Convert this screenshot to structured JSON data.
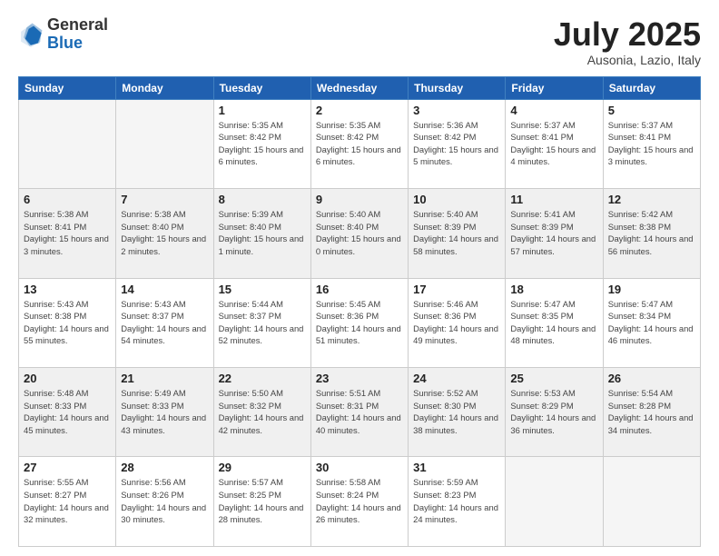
{
  "header": {
    "logo_general": "General",
    "logo_blue": "Blue",
    "month_title": "July 2025",
    "subtitle": "Ausonia, Lazio, Italy"
  },
  "weekdays": [
    "Sunday",
    "Monday",
    "Tuesday",
    "Wednesday",
    "Thursday",
    "Friday",
    "Saturday"
  ],
  "weeks": [
    [
      {
        "day": "",
        "empty": true
      },
      {
        "day": "",
        "empty": true
      },
      {
        "day": "1",
        "sunrise": "5:35 AM",
        "sunset": "8:42 PM",
        "daylight": "15 hours and 6 minutes."
      },
      {
        "day": "2",
        "sunrise": "5:35 AM",
        "sunset": "8:42 PM",
        "daylight": "15 hours and 6 minutes."
      },
      {
        "day": "3",
        "sunrise": "5:36 AM",
        "sunset": "8:42 PM",
        "daylight": "15 hours and 5 minutes."
      },
      {
        "day": "4",
        "sunrise": "5:37 AM",
        "sunset": "8:41 PM",
        "daylight": "15 hours and 4 minutes."
      },
      {
        "day": "5",
        "sunrise": "5:37 AM",
        "sunset": "8:41 PM",
        "daylight": "15 hours and 3 minutes."
      }
    ],
    [
      {
        "day": "6",
        "sunrise": "5:38 AM",
        "sunset": "8:41 PM",
        "daylight": "15 hours and 3 minutes."
      },
      {
        "day": "7",
        "sunrise": "5:38 AM",
        "sunset": "8:40 PM",
        "daylight": "15 hours and 2 minutes."
      },
      {
        "day": "8",
        "sunrise": "5:39 AM",
        "sunset": "8:40 PM",
        "daylight": "15 hours and 1 minute."
      },
      {
        "day": "9",
        "sunrise": "5:40 AM",
        "sunset": "8:40 PM",
        "daylight": "15 hours and 0 minutes."
      },
      {
        "day": "10",
        "sunrise": "5:40 AM",
        "sunset": "8:39 PM",
        "daylight": "14 hours and 58 minutes."
      },
      {
        "day": "11",
        "sunrise": "5:41 AM",
        "sunset": "8:39 PM",
        "daylight": "14 hours and 57 minutes."
      },
      {
        "day": "12",
        "sunrise": "5:42 AM",
        "sunset": "8:38 PM",
        "daylight": "14 hours and 56 minutes."
      }
    ],
    [
      {
        "day": "13",
        "sunrise": "5:43 AM",
        "sunset": "8:38 PM",
        "daylight": "14 hours and 55 minutes."
      },
      {
        "day": "14",
        "sunrise": "5:43 AM",
        "sunset": "8:37 PM",
        "daylight": "14 hours and 54 minutes."
      },
      {
        "day": "15",
        "sunrise": "5:44 AM",
        "sunset": "8:37 PM",
        "daylight": "14 hours and 52 minutes."
      },
      {
        "day": "16",
        "sunrise": "5:45 AM",
        "sunset": "8:36 PM",
        "daylight": "14 hours and 51 minutes."
      },
      {
        "day": "17",
        "sunrise": "5:46 AM",
        "sunset": "8:36 PM",
        "daylight": "14 hours and 49 minutes."
      },
      {
        "day": "18",
        "sunrise": "5:47 AM",
        "sunset": "8:35 PM",
        "daylight": "14 hours and 48 minutes."
      },
      {
        "day": "19",
        "sunrise": "5:47 AM",
        "sunset": "8:34 PM",
        "daylight": "14 hours and 46 minutes."
      }
    ],
    [
      {
        "day": "20",
        "sunrise": "5:48 AM",
        "sunset": "8:33 PM",
        "daylight": "14 hours and 45 minutes."
      },
      {
        "day": "21",
        "sunrise": "5:49 AM",
        "sunset": "8:33 PM",
        "daylight": "14 hours and 43 minutes."
      },
      {
        "day": "22",
        "sunrise": "5:50 AM",
        "sunset": "8:32 PM",
        "daylight": "14 hours and 42 minutes."
      },
      {
        "day": "23",
        "sunrise": "5:51 AM",
        "sunset": "8:31 PM",
        "daylight": "14 hours and 40 minutes."
      },
      {
        "day": "24",
        "sunrise": "5:52 AM",
        "sunset": "8:30 PM",
        "daylight": "14 hours and 38 minutes."
      },
      {
        "day": "25",
        "sunrise": "5:53 AM",
        "sunset": "8:29 PM",
        "daylight": "14 hours and 36 minutes."
      },
      {
        "day": "26",
        "sunrise": "5:54 AM",
        "sunset": "8:28 PM",
        "daylight": "14 hours and 34 minutes."
      }
    ],
    [
      {
        "day": "27",
        "sunrise": "5:55 AM",
        "sunset": "8:27 PM",
        "daylight": "14 hours and 32 minutes."
      },
      {
        "day": "28",
        "sunrise": "5:56 AM",
        "sunset": "8:26 PM",
        "daylight": "14 hours and 30 minutes."
      },
      {
        "day": "29",
        "sunrise": "5:57 AM",
        "sunset": "8:25 PM",
        "daylight": "14 hours and 28 minutes."
      },
      {
        "day": "30",
        "sunrise": "5:58 AM",
        "sunset": "8:24 PM",
        "daylight": "14 hours and 26 minutes."
      },
      {
        "day": "31",
        "sunrise": "5:59 AM",
        "sunset": "8:23 PM",
        "daylight": "14 hours and 24 minutes."
      },
      {
        "day": "",
        "empty": true
      },
      {
        "day": "",
        "empty": true
      }
    ]
  ]
}
